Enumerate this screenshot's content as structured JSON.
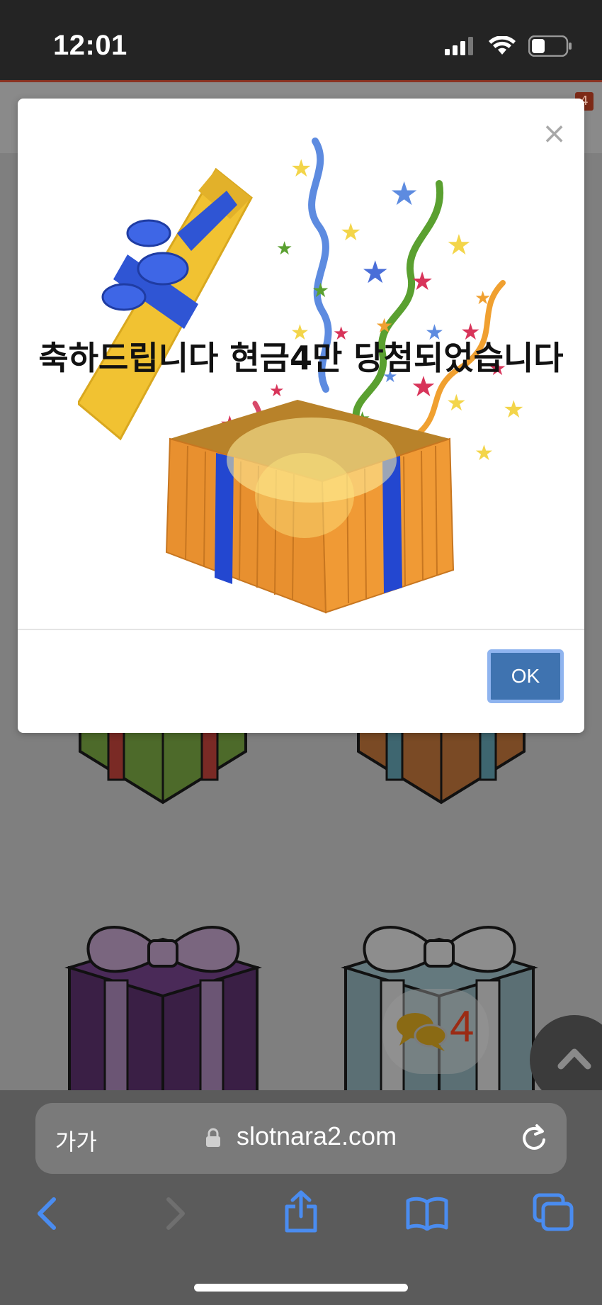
{
  "status_bar": {
    "time": "12:01"
  },
  "page": {
    "header_badge": "4",
    "chat_count": "4"
  },
  "modal": {
    "message": "축하드립니다 현금4만 당첨되었습니다",
    "ok_label": "OK",
    "close_symbol": "×"
  },
  "browser": {
    "text_size_label": "가가",
    "url": "slotnara2.com"
  },
  "colors": {
    "ok_button": "#3f73b0",
    "ok_button_border": "#8fb4ef",
    "safari_icons": "#4a8cf0",
    "badge": "#9b2b14"
  }
}
